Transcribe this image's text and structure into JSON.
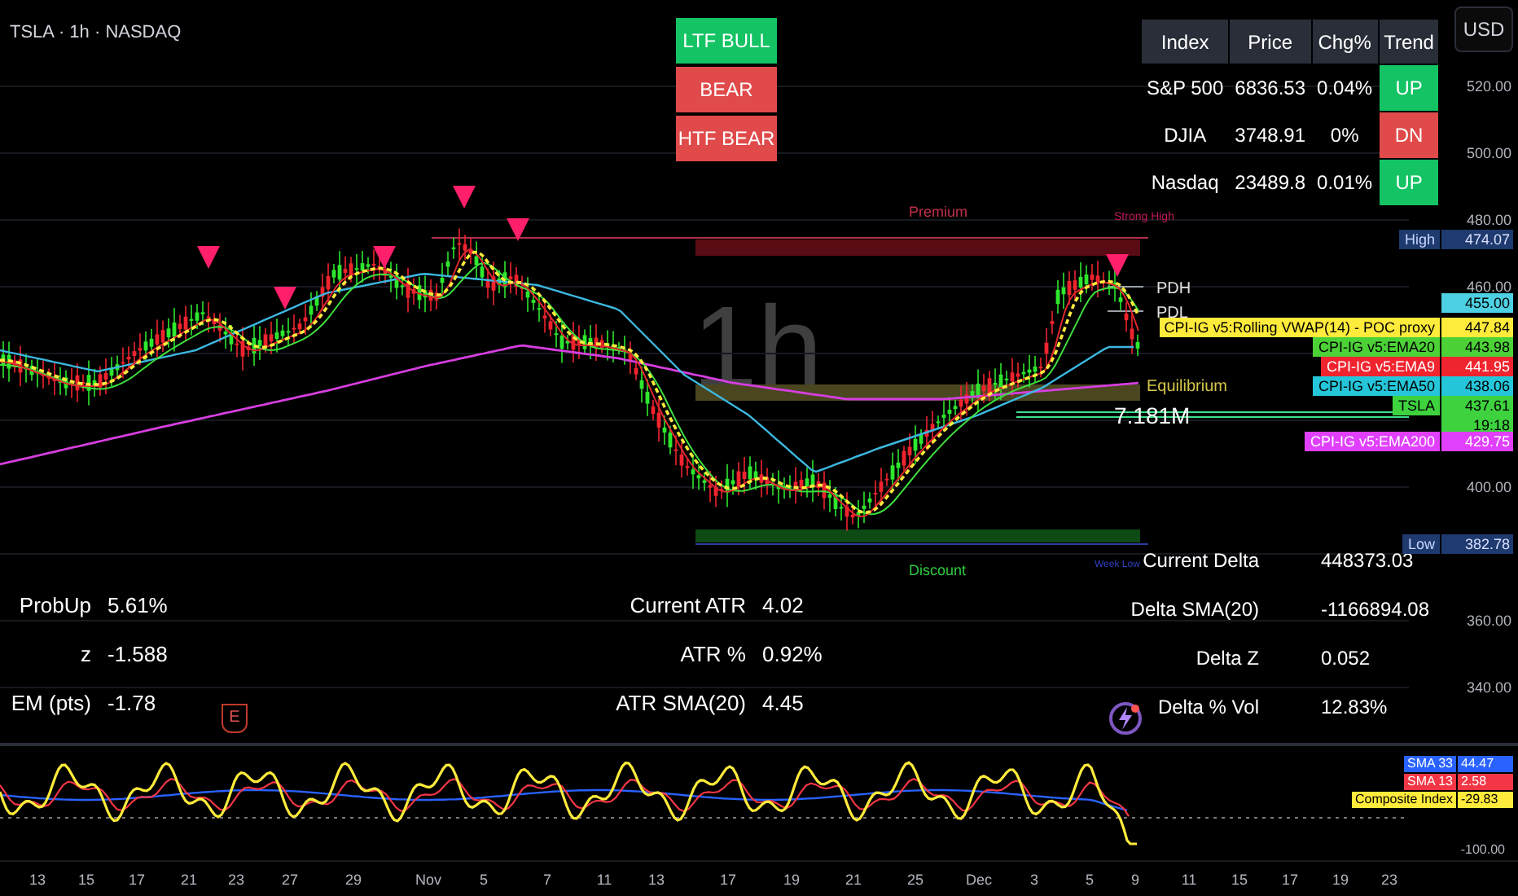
{
  "symbol_title": "TSLA · 1h · NASDAQ",
  "currency_button": "USD",
  "interval_watermark": "1h",
  "signals": [
    {
      "label": "LTF BULL",
      "kind": "bull"
    },
    {
      "label": "BEAR",
      "kind": "bear"
    },
    {
      "label": "HTF BEAR",
      "kind": "bear"
    }
  ],
  "index_table": {
    "columns": [
      "Index",
      "Price",
      "Chg%",
      "Trend"
    ],
    "rows": [
      {
        "index": "S&P 500",
        "price": "6836.53",
        "change": "0.04%",
        "trend": "UP",
        "kind": "up"
      },
      {
        "index": "DJIA",
        "price": "3748.91",
        "change": "0%",
        "trend": "DN",
        "kind": "down"
      },
      {
        "index": "Nasdaq",
        "price": "23489.8",
        "change": "0.01%",
        "trend": "UP",
        "kind": "up"
      }
    ]
  },
  "zone_labels": {
    "premium": "Premium",
    "strong_high": "Strong High",
    "pdh": "PDH",
    "pdl": "PDL",
    "equilibrium": "Equilibrium",
    "volume": "7.181M",
    "discount": "Discount",
    "week_low": "Week Low"
  },
  "price_axis": [
    "520.00",
    "500.00",
    "480.00",
    "460.00",
    "400.00",
    "360.00",
    "340.00"
  ],
  "price_badges": [
    {
      "kind": "extreme",
      "label": "High",
      "value": "474.07"
    },
    {
      "kind": "price",
      "value": "455.00",
      "color": "#4dd0e1"
    },
    {
      "kind": "indicator",
      "label": "CPI-IG v5:Rolling VWAP(14) - POC proxy",
      "value": "447.84",
      "color": "#ffeb3b"
    },
    {
      "kind": "indicator",
      "label": "CPI-IG v5:EMA20",
      "value": "443.98",
      "color": "#4cd137"
    },
    {
      "kind": "indicator",
      "label": "CPI-IG v5:EMA9",
      "value": "441.95",
      "color": "#f0242e"
    },
    {
      "kind": "indicator",
      "label": "CPI-IG v5:EMA50",
      "value": "438.06",
      "color": "#26c6da"
    },
    {
      "kind": "last",
      "label": "TSLA",
      "value": "437.61",
      "sub": "19:18",
      "color": "#3ed33e"
    },
    {
      "kind": "indicator",
      "label": "CPI-IG v5:EMA200",
      "value": "429.75",
      "color": "#e040fb"
    },
    {
      "kind": "extreme",
      "label": "Low",
      "value": "382.78"
    }
  ],
  "stats_left": [
    {
      "label": "ProbUp",
      "value": "5.61%"
    },
    {
      "label": "z",
      "value": "-1.588"
    },
    {
      "label": "EM (pts)",
      "value": "-1.78"
    }
  ],
  "stats_middle": [
    {
      "label": "Current ATR",
      "value": "4.02"
    },
    {
      "label": "ATR %",
      "value": "0.92%"
    },
    {
      "label": "ATR SMA(20)",
      "value": "4.45"
    }
  ],
  "stats_right": [
    {
      "label": "Current Delta",
      "value": "448373.03"
    },
    {
      "label": "Delta SMA(20)",
      "value": "-1166894.08"
    },
    {
      "label": "Delta Z",
      "value": "0.052"
    },
    {
      "label": "Delta % Vol",
      "value": "12.83%"
    }
  ],
  "earnings_marker": "E",
  "oscillator_legend": [
    {
      "label": "SMA 33",
      "value": "44.47",
      "color": "#2962ff"
    },
    {
      "label": "SMA 13",
      "value": "2.58",
      "color": "#f23645"
    },
    {
      "label": "Composite Index",
      "value": "-29.83",
      "color": "#ffeb3b"
    }
  ],
  "oscillator_axis": "-100.00",
  "date_axis": [
    "13",
    "15",
    "17",
    "21",
    "23",
    "27",
    "29",
    "Nov",
    "5",
    "7",
    "11",
    "13",
    "17",
    "19",
    "21",
    "25",
    "Dec",
    "3",
    "5",
    "9",
    "11",
    "15",
    "17",
    "19",
    "23"
  ]
}
